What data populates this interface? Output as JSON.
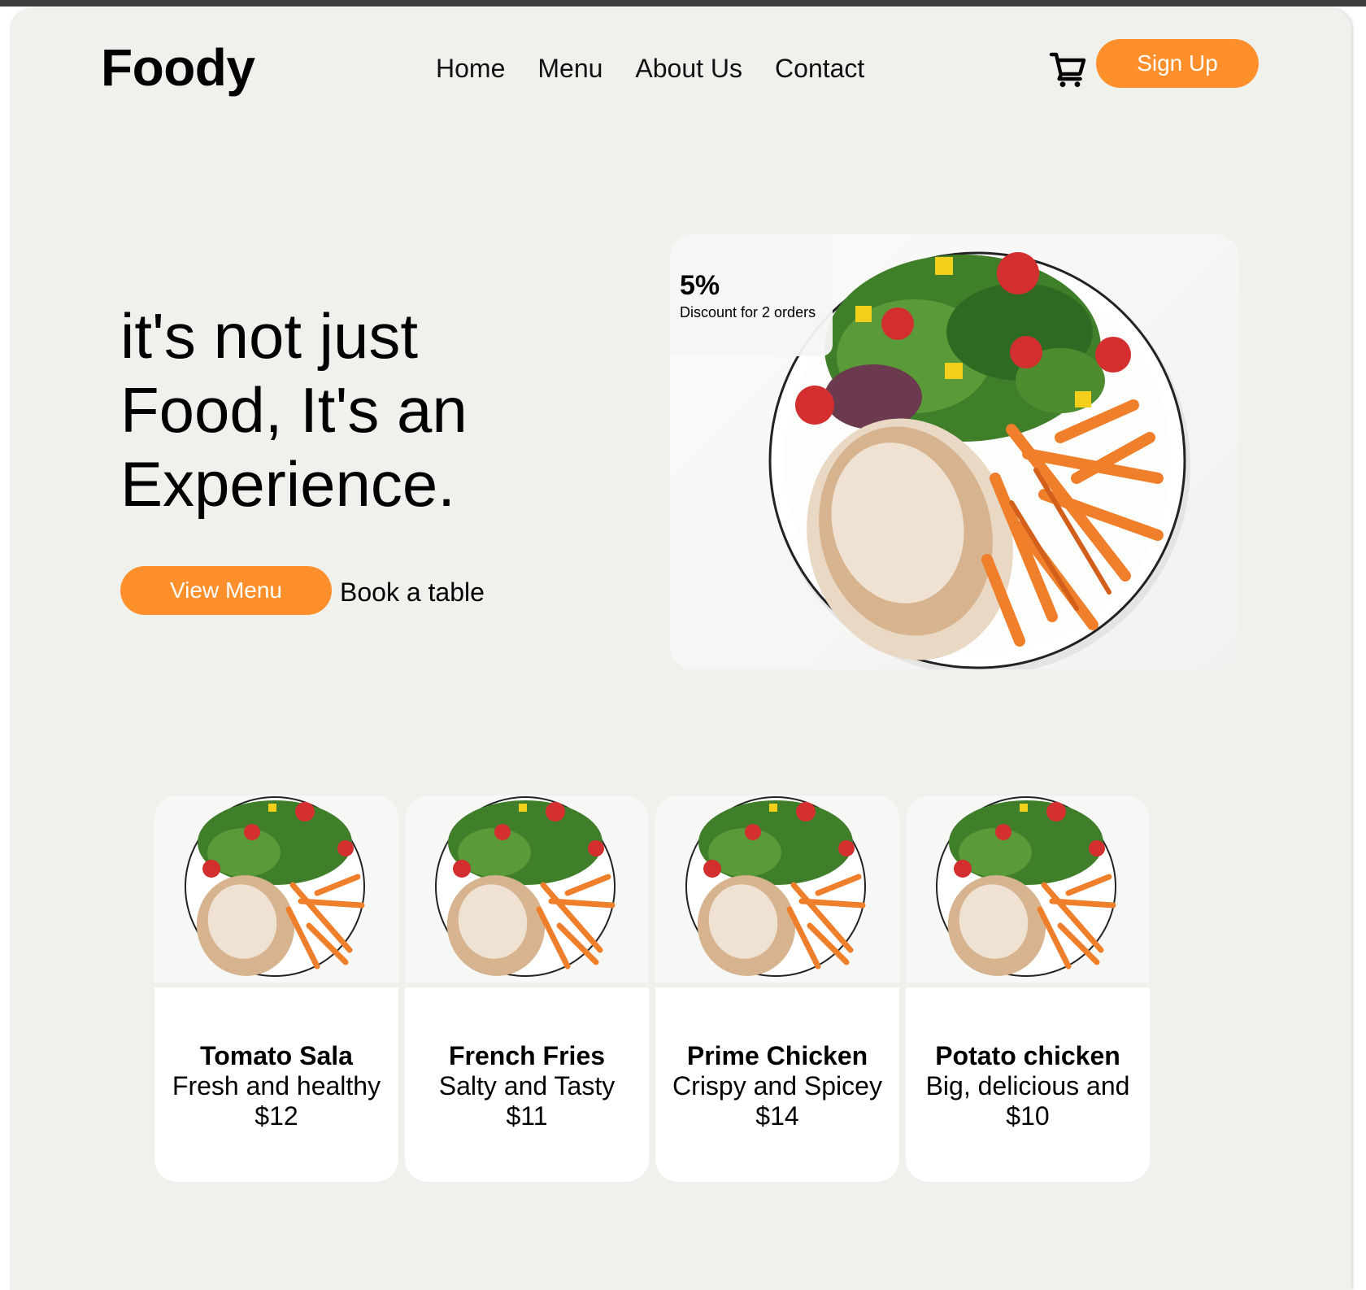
{
  "header": {
    "logo": "Foody",
    "nav": [
      "Home",
      "Menu",
      "About Us",
      "Contact"
    ],
    "cart_icon": "cart-icon",
    "signup_label": "Sign Up"
  },
  "hero": {
    "title_lines": [
      "it's not just",
      "Food, It's an",
      "Experience."
    ],
    "view_menu_label": "View Menu",
    "book_label": "Book a table",
    "discount": {
      "percent": "5%",
      "text": "Discount for 2 orders"
    }
  },
  "cards": [
    {
      "name": "Tomato Sala",
      "desc": "Fresh and healthy",
      "price": "$12"
    },
    {
      "name": "French Fries",
      "desc": "Salty and Tasty",
      "price": "$11"
    },
    {
      "name": "Prime Chicken",
      "desc": "Crispy and Spicey",
      "price": "$14"
    },
    {
      "name": "Potato chicken",
      "desc": "Big, delicious and",
      "price": "$10"
    }
  ],
  "colors": {
    "accent": "#ff8f2b",
    "page_bg": "#f0f0ed",
    "card_bg": "#ffffff"
  }
}
